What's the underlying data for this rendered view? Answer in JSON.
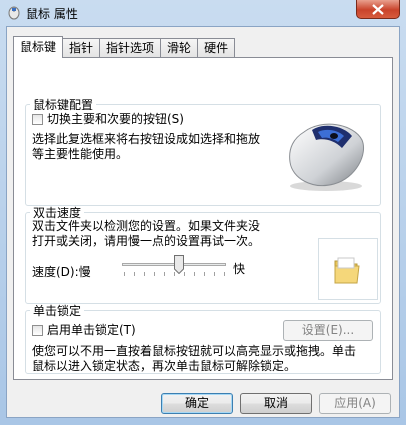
{
  "window": {
    "title": "鼠标 属性"
  },
  "tabs": [
    {
      "label": "鼠标键"
    },
    {
      "label": "指针"
    },
    {
      "label": "指针选项"
    },
    {
      "label": "滑轮"
    },
    {
      "label": "硬件"
    }
  ],
  "buttons_config": {
    "legend": "鼠标键配置",
    "switch_checkbox_label": "切换主要和次要的按钮(S)",
    "description_line1": "选择此复选框来将右按钮设成如选择和拖放",
    "description_line2": "等主要性能使用。"
  },
  "double_click": {
    "legend": "双击速度",
    "description_line1": "双击文件夹以检测您的设置。如果文件夹没",
    "description_line2": "打开或关闭，请用慢一点的设置再试一次。",
    "speed_label": "速度(D):慢",
    "fast_label": "快",
    "speed_level": 0.55
  },
  "click_lock": {
    "legend": "单击锁定",
    "enable_checkbox_label": "启用单击锁定(T)",
    "settings_button": "设置(E)...",
    "description_line1": "使您可以不用一直按着鼠标按钮就可以高亮显示或拖拽。单击",
    "description_line2": "鼠标以进入锁定状态，再次单击鼠标可解除锁定。"
  },
  "footer": {
    "ok": "确定",
    "cancel": "取消",
    "apply": "应用(A)"
  }
}
